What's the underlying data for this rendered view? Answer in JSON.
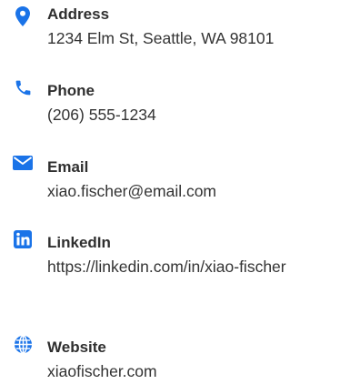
{
  "accent_color": "#1a73e8",
  "contacts": [
    {
      "icon": "map-pin-icon",
      "label": "Address",
      "value": "1234 Elm St, Seattle, WA 98101"
    },
    {
      "icon": "phone-icon",
      "label": "Phone",
      "value": "(206) 555-1234"
    },
    {
      "icon": "envelope-icon",
      "label": "Email",
      "value": "xiao.fischer@email.com"
    },
    {
      "icon": "linkedin-icon",
      "label": "LinkedIn",
      "value": "https://linkedin.com/in/xiao-fischer"
    },
    {
      "icon": "globe-icon",
      "label": "Website",
      "value": "xiaofischer.com"
    }
  ]
}
